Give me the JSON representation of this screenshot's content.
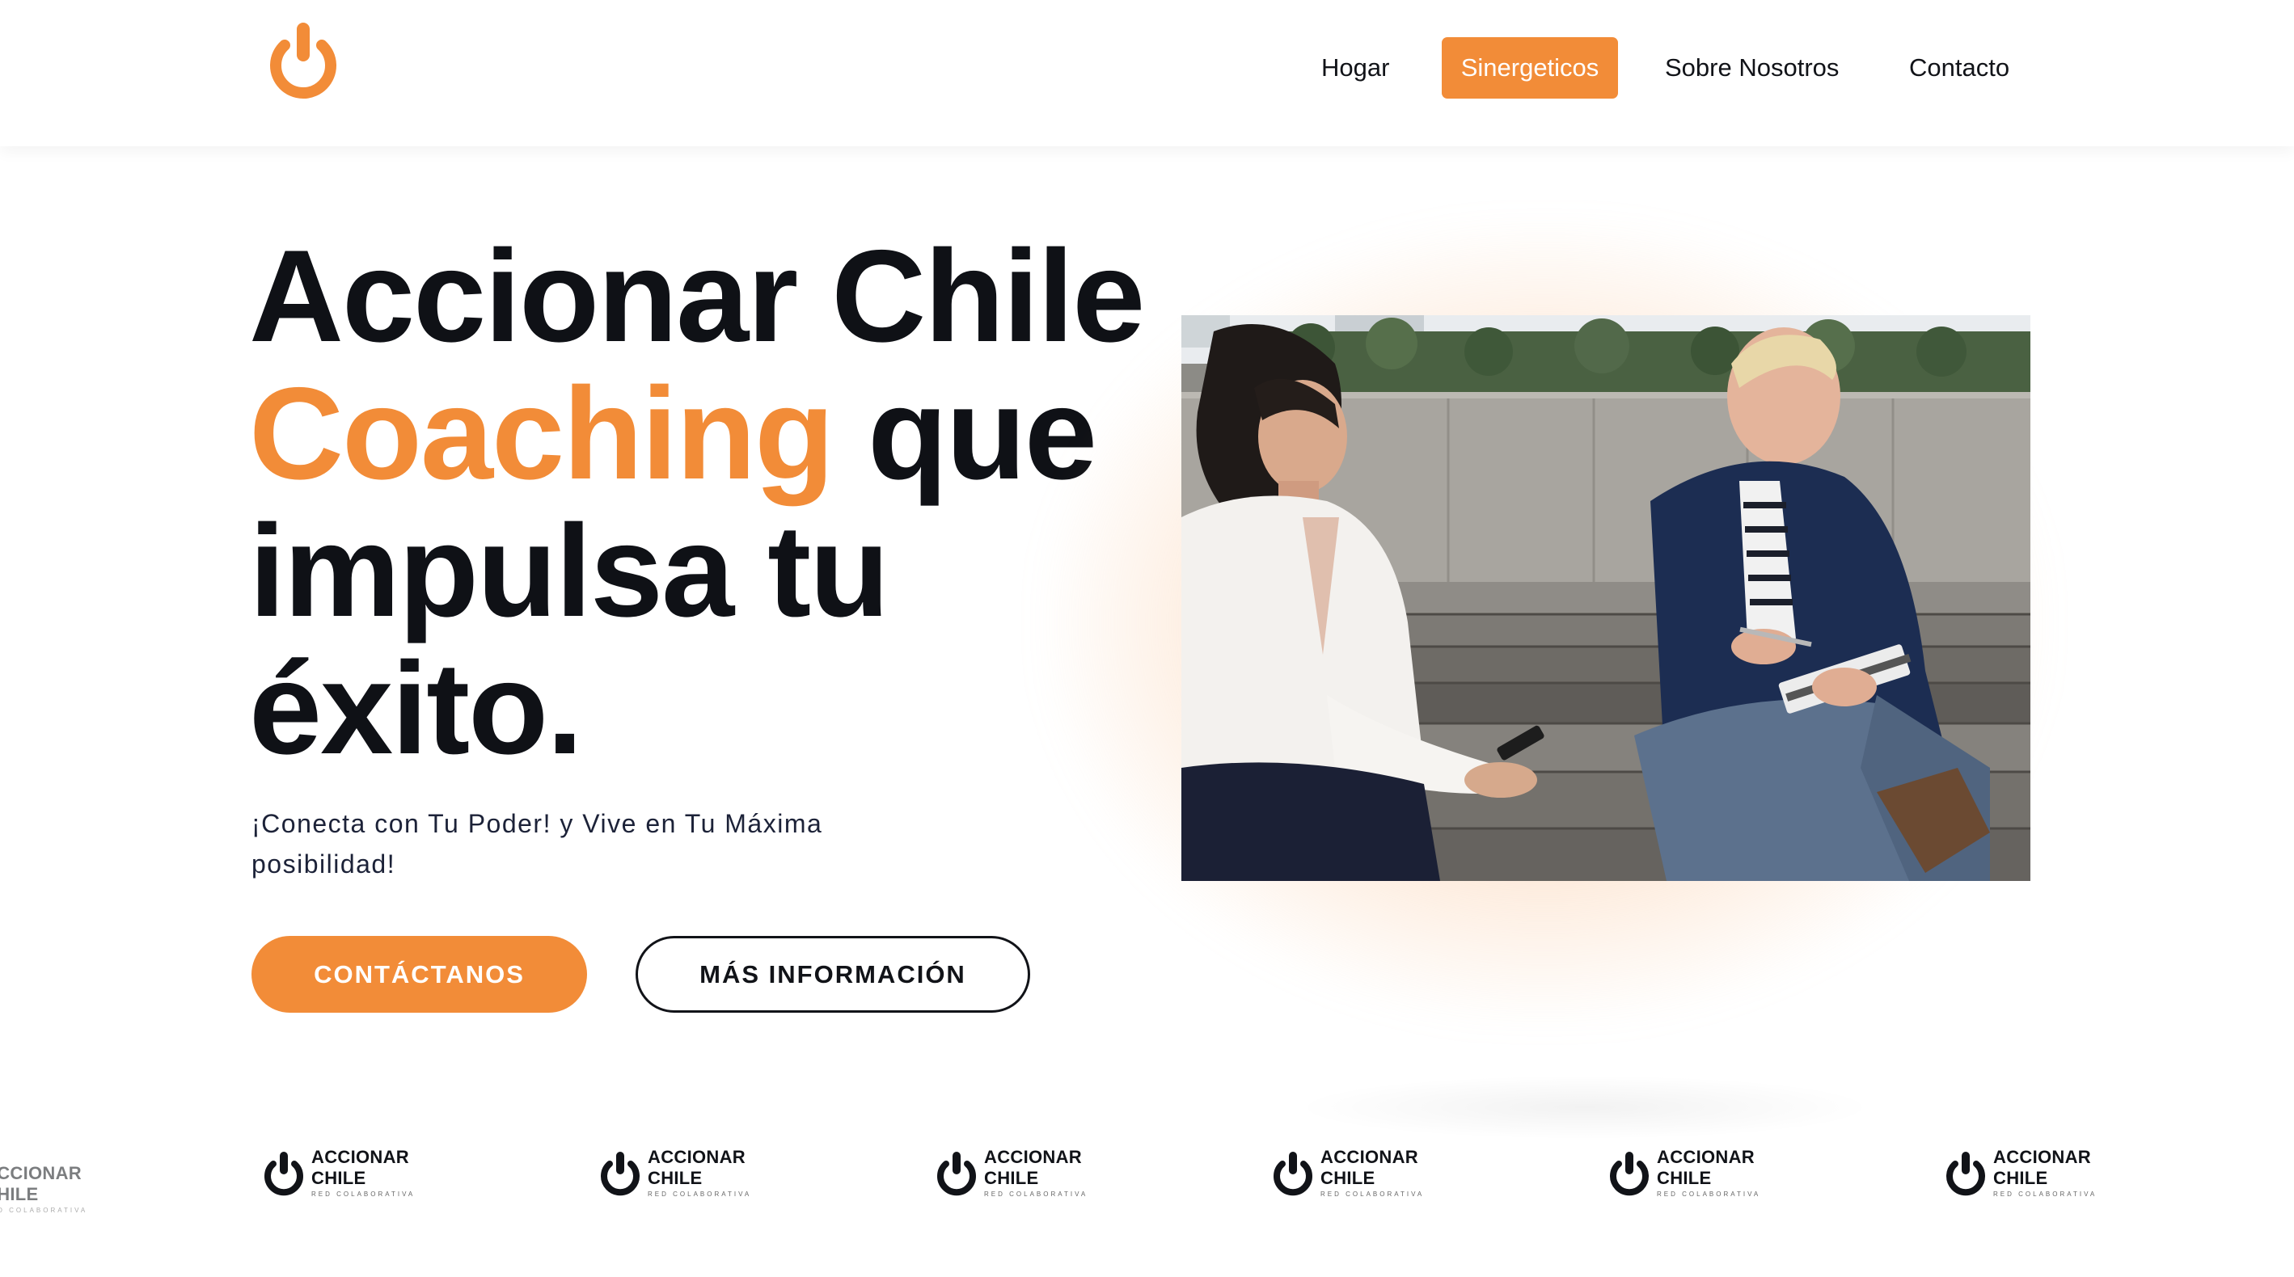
{
  "brand": {
    "accent_color": "#f28c38",
    "logo_icon": "power-icon"
  },
  "nav": {
    "items": [
      {
        "label": "Hogar",
        "active": false
      },
      {
        "label": "Sinergeticos",
        "active": true
      },
      {
        "label": "Sobre Nosotros",
        "active": false
      },
      {
        "label": "Contacto",
        "active": false
      }
    ]
  },
  "hero": {
    "title_line1": "Accionar Chile",
    "title_accent": "Coaching",
    "title_line2_rest": " que",
    "title_line3": "impulsa tu",
    "title_line4": "éxito.",
    "subtitle": "¡Conecta con Tu Poder! y Vive en Tu Máxima posibilidad!",
    "primary_button": "CONTÁCTANOS",
    "secondary_button": "MÁS INFORMACIÓN"
  },
  "logo_strip": {
    "items": [
      {
        "line1": "ACCIONAR",
        "line2": "CHILE",
        "tag": "RED COLABORATIVA"
      },
      {
        "line1": "ACCIONAR",
        "line2": "CHILE",
        "tag": "RED COLABORATIVA"
      },
      {
        "line1": "ACCIONAR",
        "line2": "CHILE",
        "tag": "RED COLABORATIVA"
      },
      {
        "line1": "ACCIONAR",
        "line2": "CHILE",
        "tag": "RED COLABORATIVA"
      },
      {
        "line1": "ACCIONAR",
        "line2": "CHILE",
        "tag": "RED COLABORATIVA"
      },
      {
        "line1": "ACCIONAR",
        "line2": "CHILE",
        "tag": "RED COLABORATIVA"
      },
      {
        "line1": "ACCIONAR",
        "line2": "CHILE",
        "tag": "RED COLABORATIVA"
      }
    ]
  }
}
